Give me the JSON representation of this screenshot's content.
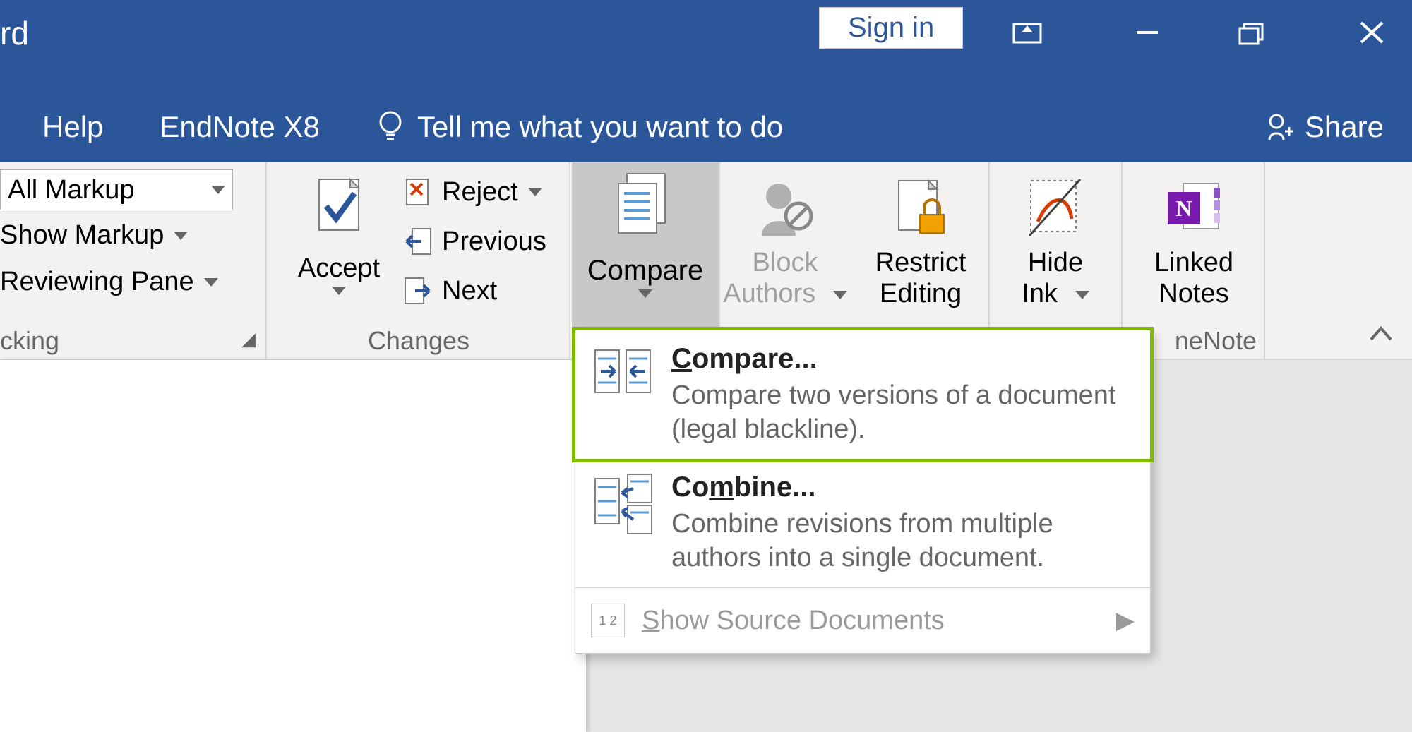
{
  "titlebar": {
    "app_title_fragment": "rd",
    "sign_in": "Sign in"
  },
  "tabs": {
    "help": "Help",
    "endnote": "EndNote X8",
    "tell_me": "Tell me what you want to do",
    "share": "Share"
  },
  "ribbon": {
    "tracking": {
      "combo_value": "All Markup",
      "show_markup": "Show Markup",
      "reviewing_pane": "Reviewing Pane",
      "group_label": "cking"
    },
    "changes": {
      "accept": "Accept",
      "reject": "Reject",
      "previous": "Previous",
      "next": "Next",
      "group_label": "Changes"
    },
    "compare": {
      "label": "Compare"
    },
    "protect": {
      "block_authors_line1": "Block",
      "block_authors_line2": "Authors",
      "restrict_line1": "Restrict",
      "restrict_line2": "Editing"
    },
    "ink": {
      "line1": "Hide",
      "line2": "Ink"
    },
    "onenote": {
      "line1": "Linked",
      "line2": "Notes",
      "group_label": "neNote"
    }
  },
  "compare_menu": {
    "compare": {
      "title": "Compare...",
      "desc": "Compare two versions of a document (legal blackline)."
    },
    "combine": {
      "title": "Combine...",
      "desc": "Combine revisions from multiple authors into a single document."
    },
    "show_source": "Show Source Documents"
  }
}
